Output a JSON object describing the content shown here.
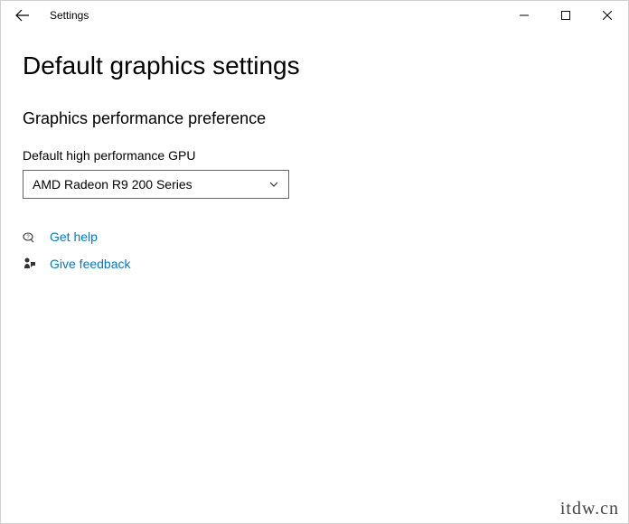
{
  "window": {
    "app_title": "Settings"
  },
  "page": {
    "title": "Default graphics settings",
    "section_title": "Graphics performance preference",
    "gpu_label": "Default high performance GPU",
    "gpu_selected": "AMD Radeon R9 200 Series"
  },
  "links": {
    "get_help": "Get help",
    "give_feedback": "Give feedback"
  },
  "watermark": "itdw.cn"
}
